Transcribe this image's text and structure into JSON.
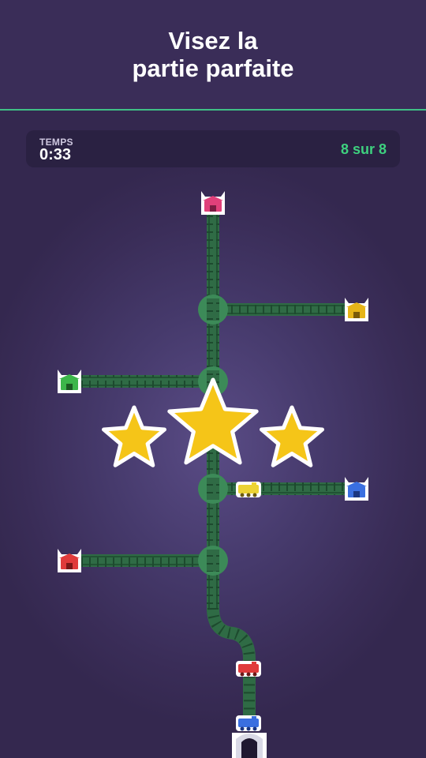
{
  "header": {
    "title_line1": "Visez la",
    "title_line2": "partie parfaite"
  },
  "hud": {
    "time_label": "TEMPS",
    "time_value": "0:33",
    "score": "8 sur 8"
  },
  "colors": {
    "background": "#3a2d58",
    "track": "#2f6b45",
    "switch": "#3c8a58",
    "accent": "#3ed17f",
    "star": "#f5c518"
  },
  "stars": {
    "earned": 3,
    "total": 3
  },
  "stations": [
    {
      "color": "#e0407a",
      "name": "pink-station"
    },
    {
      "color": "#e6b418",
      "name": "yellow-station"
    },
    {
      "color": "#3cb64a",
      "name": "green-station"
    },
    {
      "color": "#3a6fe0",
      "name": "blue-station"
    },
    {
      "color": "#e03b3b",
      "name": "red-station"
    }
  ],
  "trains": [
    {
      "color": "#ecd335",
      "name": "yellow-train"
    },
    {
      "color": "#e03b3b",
      "name": "red-train"
    },
    {
      "color": "#3a6fe0",
      "name": "blue-train"
    }
  ]
}
